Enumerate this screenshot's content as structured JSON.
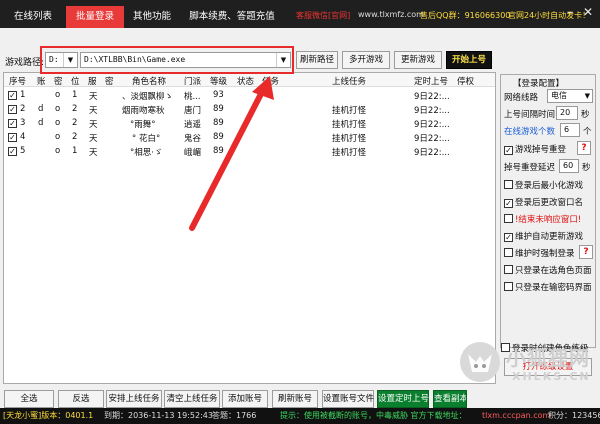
{
  "tabs": [
    {
      "label": "在线列表"
    },
    {
      "label": "批量登录"
    },
    {
      "label": "其他功能"
    },
    {
      "label": "脚本续费、答题充值"
    }
  ],
  "title_links": {
    "service": "客服微信[官网]",
    "site": "www.tlxmfz.com",
    "qq": "售后QQ群：916066300",
    "notice": "官网24小时自动发卡！"
  },
  "path_bar": {
    "label": "游戏路径:",
    "drive": "D:",
    "path": "D:\\XTLBB\\Bin\\Game.exe",
    "refresh": "刷新路径",
    "multi": "多开游戏",
    "update": "更新游戏",
    "start": "开始上号"
  },
  "table": {
    "headers": [
      "序号",
      "账",
      "密",
      "位",
      "服",
      "密",
      "角色名称",
      "门派",
      "等级",
      "状态",
      "任务",
      "上线任务",
      "定时上号",
      "停权"
    ],
    "rows": [
      {
        "no": "1",
        "acc": "",
        "pwd": "o",
        "pos": "1",
        "srv": "天",
        "pw2": "",
        "name": "、淡烟飘柳ゝ",
        "school": "桃...",
        "level": "93",
        "state": "",
        "task": "",
        "online": "",
        "timer": "9日22:...",
        "ban": "",
        "checked": true
      },
      {
        "no": "2",
        "acc": "d",
        "pwd": "o",
        "pos": "2",
        "srv": "天",
        "pw2": "",
        "name": "烟雨吻寒秋",
        "school": "唐门",
        "level": "89",
        "state": "",
        "task": "",
        "online": "挂机打怪",
        "timer": "9日22:...",
        "ban": "",
        "checked": true
      },
      {
        "no": "3",
        "acc": "d",
        "pwd": "o",
        "pos": "2",
        "srv": "天",
        "pw2": "",
        "name": "°雨舞°",
        "school": "逍遥",
        "level": "89",
        "state": "",
        "task": "",
        "online": "挂机打怪",
        "timer": "9日22:...",
        "ban": "",
        "checked": true
      },
      {
        "no": "4",
        "acc": "",
        "pwd": "o",
        "pos": "2",
        "srv": "天",
        "pw2": "",
        "name": "° 花白°",
        "school": "鬼谷",
        "level": "89",
        "state": "",
        "task": "",
        "online": "挂机打怪",
        "timer": "9日22:...",
        "ban": "",
        "checked": true
      },
      {
        "no": "5",
        "acc": "",
        "pwd": "o",
        "pos": "1",
        "srv": "天",
        "pw2": "",
        "name": "°相思·ゞ",
        "school": "峨嵋",
        "level": "89",
        "state": "",
        "task": "",
        "online": "挂机打怪",
        "timer": "9日22:...",
        "ban": "",
        "checked": true
      }
    ]
  },
  "panel": {
    "title": "【登录配置】",
    "line_label": "网络线路",
    "line_value": "电信",
    "interval_label": "上号间隔时间",
    "interval_value": "20",
    "interval_unit": "秒",
    "online_label": "在线游戏个数",
    "online_value": "6",
    "online_unit": "个",
    "reconnect_label": "游戏掉号重登",
    "retry_label": "掉号重登延迟",
    "retry_value": "60",
    "retry_unit": "秒",
    "opt_minimize": "登录后最小化游戏",
    "opt_rename": "登录后更改窗口名",
    "opt_end": "!结束未响应窗口!",
    "opt_auto_update": "维护自动更新游戏",
    "opt_force": "维护时强制登录",
    "opt_select_page": "只登录在选角色页面",
    "opt_pwd_page": "只登录在输密码界面",
    "opt_create_role": "登录时创建角色练级",
    "open_settings": "打开练级设置",
    "help": "?"
  },
  "bottom_buttons": {
    "select_all": "全选",
    "invert": "反选",
    "arrange": "安排上线任务",
    "clear": "清空上线任务",
    "add": "添加账号",
    "refresh": "刷新账号",
    "set_file": "设置账号文件",
    "set_timer": "设置定时上号",
    "view": "查看副本"
  },
  "status": {
    "version": "[天龙小蜜]版本：0401.1",
    "expire": "到期：2036-11-13 19:52:43",
    "answers": "答题：1766",
    "tip": "提示：使用被截断的账号，中毒威胁 官方下载地址：",
    "url": "tlxm.cccpan.com",
    "credit": "积分：123456"
  },
  "watermark": {
    "cn": "小狐狸网",
    "en": "XHLKS.CN"
  },
  "colors": {
    "tab_active": "#e93a3a",
    "title_bg": "#1f1f1f",
    "green_button": "#0a7f2e",
    "highlight_red": "#e82a2a",
    "link_blue": "#1a5fd3"
  }
}
